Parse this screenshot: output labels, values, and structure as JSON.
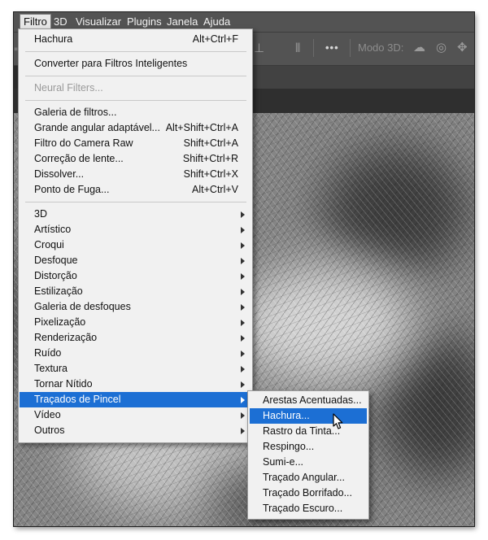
{
  "menubar": {
    "items": [
      {
        "label": "Filtro",
        "active": true
      },
      {
        "label": "3D"
      },
      {
        "label": "Visualizar"
      },
      {
        "label": "Plugins"
      },
      {
        "label": "Janela"
      },
      {
        "label": "Ajuda"
      }
    ]
  },
  "options_bar": {
    "more_label": "•••",
    "mode3d_label": "Modo 3D:"
  },
  "filter_menu": {
    "items": [
      {
        "label": "Hachura",
        "shortcut": "Alt+Ctrl+F"
      },
      {
        "label": "Converter para Filtros Inteligentes"
      },
      {
        "label": "Neural Filters...",
        "disabled": true
      },
      {
        "label": "Galeria de filtros..."
      },
      {
        "label": "Grande angular adaptável...",
        "shortcut": "Alt+Shift+Ctrl+A"
      },
      {
        "label": "Filtro do Camera Raw",
        "shortcut": "Shift+Ctrl+A"
      },
      {
        "label": "Correção de lente...",
        "shortcut": "Shift+Ctrl+R"
      },
      {
        "label": "Dissolver...",
        "shortcut": "Shift+Ctrl+X"
      },
      {
        "label": "Ponto de Fuga...",
        "shortcut": "Alt+Ctrl+V"
      },
      {
        "label": "3D",
        "submenu": true
      },
      {
        "label": "Artístico",
        "submenu": true
      },
      {
        "label": "Croqui",
        "submenu": true
      },
      {
        "label": "Desfoque",
        "submenu": true
      },
      {
        "label": "Distorção",
        "submenu": true
      },
      {
        "label": "Estilização",
        "submenu": true
      },
      {
        "label": "Galeria de desfoques",
        "submenu": true
      },
      {
        "label": "Pixelização",
        "submenu": true
      },
      {
        "label": "Renderização",
        "submenu": true
      },
      {
        "label": "Ruído",
        "submenu": true
      },
      {
        "label": "Textura",
        "submenu": true
      },
      {
        "label": "Tornar Nítido",
        "submenu": true
      },
      {
        "label": "Traçados de Pincel",
        "submenu": true,
        "highlighted": true
      },
      {
        "label": "Vídeo",
        "submenu": true
      },
      {
        "label": "Outros",
        "submenu": true
      }
    ]
  },
  "brush_strokes_submenu": {
    "items": [
      {
        "label": "Arestas Acentuadas..."
      },
      {
        "label": "Hachura...",
        "highlighted": true
      },
      {
        "label": "Rastro da Tinta..."
      },
      {
        "label": "Respingo..."
      },
      {
        "label": "Sumi-e..."
      },
      {
        "label": "Traçado Angular..."
      },
      {
        "label": "Traçado Borrifado..."
      },
      {
        "label": "Traçado Escuro..."
      }
    ]
  },
  "colors": {
    "highlight": "#1c6fd4",
    "menu_bg": "#f1f1f1",
    "menubar_bg": "#535353"
  }
}
